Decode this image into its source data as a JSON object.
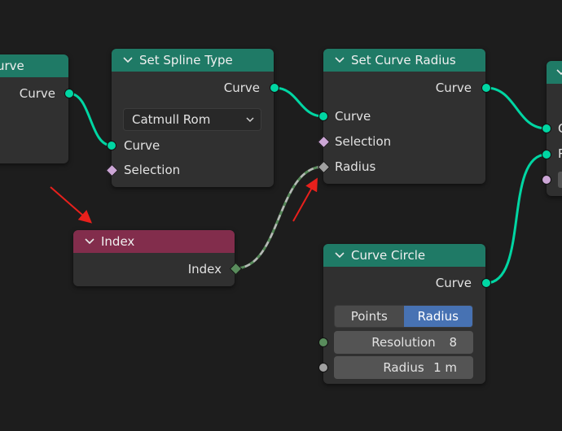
{
  "nodes": {
    "partial_left": {
      "title": "urve",
      "output": "Curve"
    },
    "set_spline_type": {
      "title": "Set Spline Type",
      "output": "Curve",
      "dropdown_value": "Catmull Rom",
      "inputs": [
        "Curve",
        "Selection"
      ]
    },
    "set_curve_radius": {
      "title": "Set Curve Radius",
      "output": "Curve",
      "inputs": [
        "Curve",
        "Selection",
        "Radius"
      ]
    },
    "index": {
      "title": "Index",
      "output": "Index"
    },
    "curve_circle": {
      "title": "Curve Circle",
      "output": "Curve",
      "mode_options": [
        "Points",
        "Radius"
      ],
      "mode_selected": "Radius",
      "resolution_label": "Resolution",
      "resolution_value": "8",
      "radius_label": "Radius",
      "radius_value": "1 m"
    },
    "partial_right": {
      "input_initials": [
        "C",
        "R"
      ]
    }
  },
  "icons": {
    "collapse": "chevron-down-icon",
    "dropdown": "chevron-down-icon",
    "annotation": "red-arrow-icon"
  },
  "colors": {
    "geometry_header": "#1f7a66",
    "input_header": "#822d4c",
    "geometry_socket": "#00d6a3",
    "selected_mode": "#4772b3",
    "annotation": "#e8201c"
  }
}
